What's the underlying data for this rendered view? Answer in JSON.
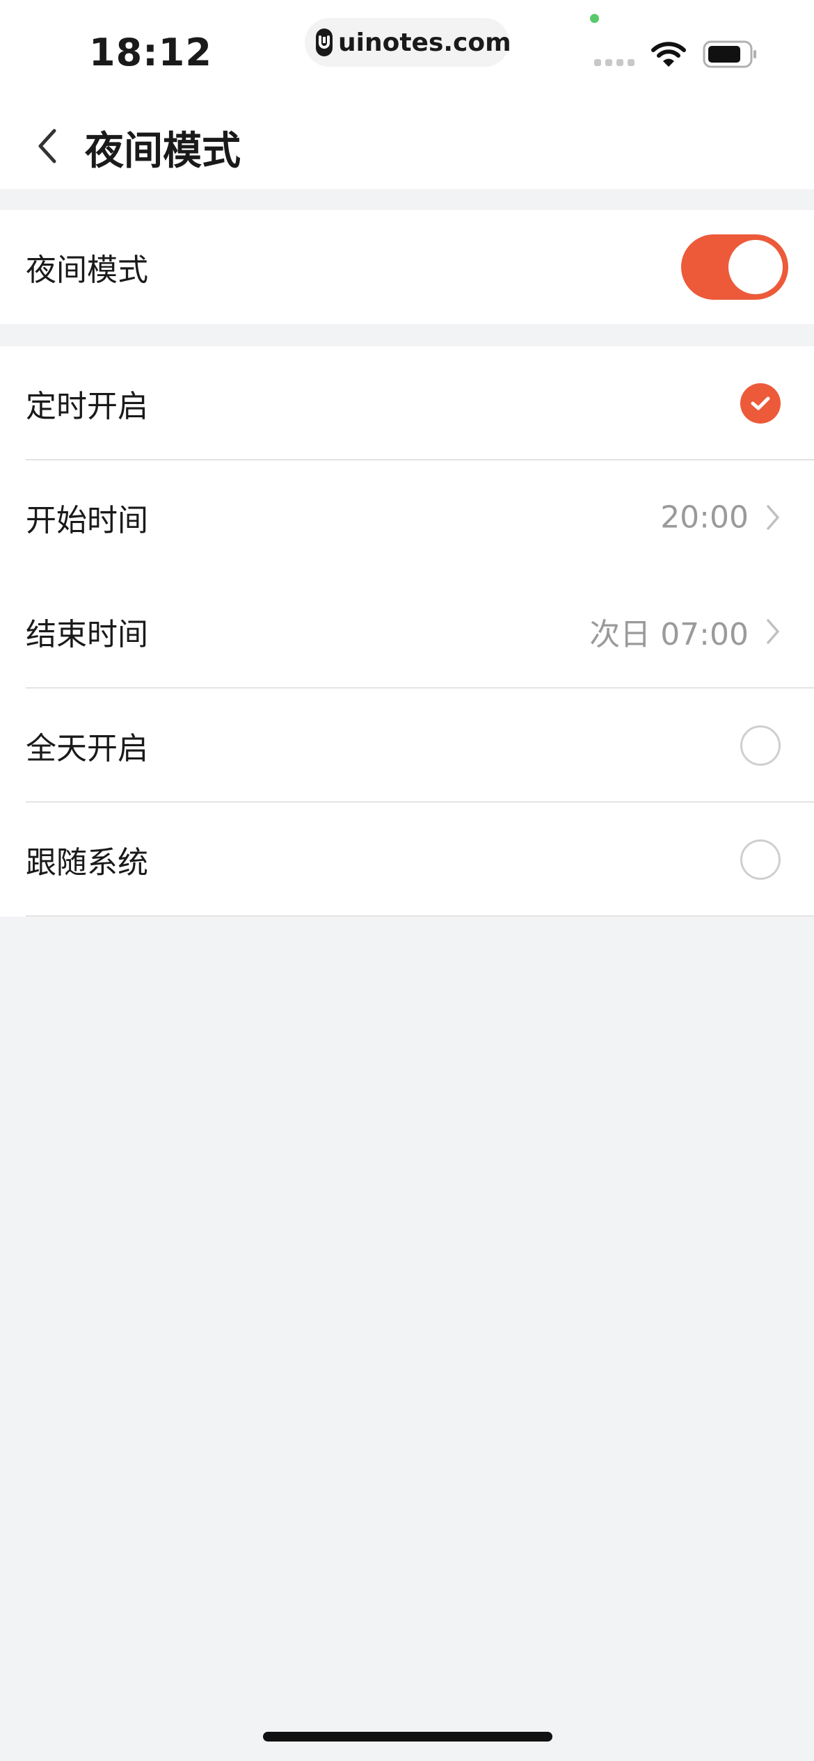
{
  "status_bar": {
    "time": "18:12",
    "url": "uinotes.com",
    "icons": [
      "signal-icon",
      "wifi-icon",
      "battery-icon"
    ]
  },
  "nav": {
    "title": "夜间模式",
    "back_icon": "chevron-left-icon"
  },
  "night_mode": {
    "label": "夜间模式",
    "enabled": true
  },
  "options": [
    {
      "label": "定时开启",
      "selected": true
    },
    {
      "label": "开始时间",
      "value": "20:00"
    },
    {
      "label": "结束时间",
      "value": "次日 07:00"
    },
    {
      "label": "全天开启",
      "selected": false
    },
    {
      "label": "跟随系统",
      "selected": false
    }
  ],
  "colors": {
    "accent": "#ec5a3a",
    "background": "#f2f3f5",
    "secondary_text": "#9a9a9a"
  }
}
